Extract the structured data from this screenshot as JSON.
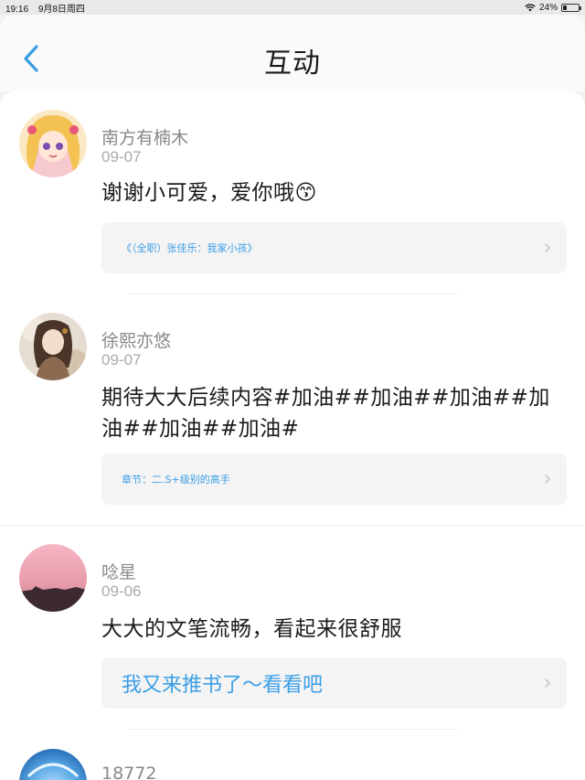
{
  "status_bar": {
    "time": "19:16",
    "date": "9月8日周四",
    "battery": "24%",
    "battery_level": 0.24
  },
  "header": {
    "title": "互动",
    "back_icon": "chevron-left-icon"
  },
  "comments": [
    {
      "author": "南方有楠木",
      "date": "09-07",
      "text": "谢谢小可爱，爱你哦😙",
      "ref_label": "《（全职）张佳乐：我家小孩》",
      "ref_icon": "chevron-right-icon"
    },
    {
      "author": "徐熙亦悠",
      "date": "09-07",
      "text": "期待大大后续内容#加油##加油##加油##加油##加油##加油#",
      "ref_label": "章节：二.S+级别的高手",
      "ref_icon": "chevron-right-icon"
    },
    {
      "author": "唸星",
      "date": "09-06",
      "text": "大大的文笔流畅，看起来很舒服",
      "ref_label": "我又来推书了～看看吧",
      "ref_icon": "chevron-right-icon"
    },
    {
      "author": "18772"
    }
  ],
  "colors": {
    "accent": "#3a9ee6",
    "background": "#f2f2f2",
    "card": "#ffffff",
    "ref_background": "#f4f4f4"
  }
}
